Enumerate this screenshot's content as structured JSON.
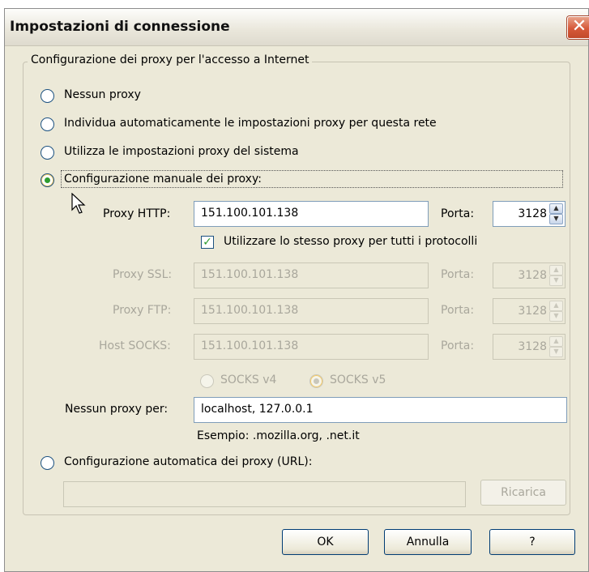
{
  "window": {
    "title": "Impostazioni di connessione",
    "close_glyph": "✕"
  },
  "group": {
    "legend": "Configurazione dei proxy per l'accesso a Internet"
  },
  "options": {
    "no_proxy": "Nessun proxy",
    "auto_detect": "Individua automaticamente le impostazioni proxy per questa rete",
    "system": "Utilizza le impostazioni proxy del sistema",
    "manual": "Configurazione manuale dei proxy:",
    "auto_url": "Configurazione automatica dei proxy (URL):",
    "selected": "manual"
  },
  "proxies": {
    "http": {
      "label": "Proxy HTTP:",
      "value": "151.100.101.138",
      "port_label": "Porta:",
      "port": "3128"
    },
    "same_for_all": {
      "label": "Utilizzare lo stesso proxy per tutti i protocolli",
      "checked": true
    },
    "ssl": {
      "label": "Proxy SSL:",
      "value": "151.100.101.138",
      "port_label": "Porta:",
      "port": "3128"
    },
    "ftp": {
      "label": "Proxy FTP:",
      "value": "151.100.101.138",
      "port_label": "Porta:",
      "port": "3128"
    },
    "socks": {
      "label": "Host SOCKS:",
      "value": "151.100.101.138",
      "port_label": "Porta:",
      "port": "3128"
    },
    "socks_v4": "SOCKS v4",
    "socks_v5": "SOCKS v5"
  },
  "no_proxy_for": {
    "label": "Nessun proxy per:",
    "value": "localhost, 127.0.0.1",
    "example": "Esempio: .mozilla.org, .net.it"
  },
  "auto_url": {
    "value": "",
    "reload_label": "Ricarica"
  },
  "buttons": {
    "ok": "OK",
    "cancel": "Annulla",
    "help": "?"
  },
  "colors": {
    "dialog_bg": "#ece9d8",
    "input_border": "#7f9db9",
    "radio_selected": "#2f9c2f",
    "close_button": "#d6593a"
  }
}
